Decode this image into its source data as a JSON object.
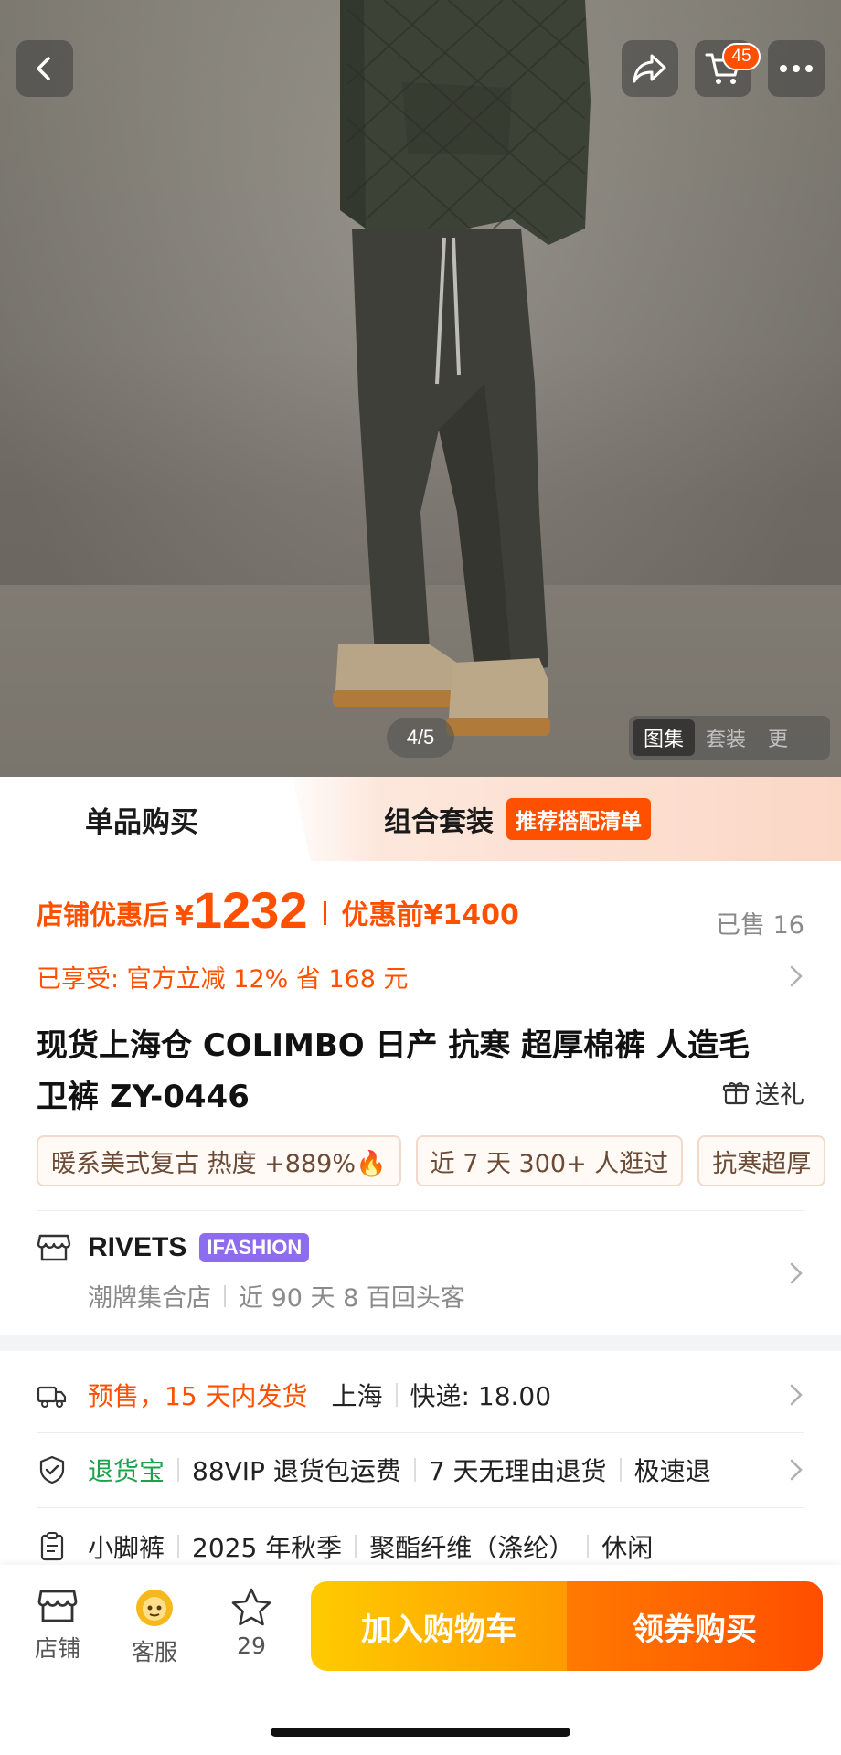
{
  "gallery": {
    "counter": "4/5",
    "tabs": [
      "图集",
      "套装",
      "更"
    ]
  },
  "header": {
    "cart_count": "45"
  },
  "mode_tabs": {
    "single": "单品购买",
    "combo": "组合套装",
    "combo_tag": "推荐搭配清单"
  },
  "price": {
    "label": "店铺优惠后",
    "symbol": "¥",
    "value": "1232",
    "before": "优惠前¥1400",
    "sold": "已售 16"
  },
  "discount": {
    "text": "已享受: 官方立减 12% 省 168 元"
  },
  "title": {
    "line1": "现货上海仓 COLIMBO 日产 抗寒 超厚棉裤 人造毛",
    "line2": "卫裤 ZY-0446",
    "gift": "送礼"
  },
  "tags": [
    "暖系美式复古 热度 +889%🔥",
    "近 7 天 300+ 人逛过",
    "抗寒超厚"
  ],
  "shop": {
    "name": "RIVETS",
    "badge": "IFASHION",
    "category": "潮牌集合店",
    "returning": "近 90 天 8 百回头客"
  },
  "shipping": {
    "presale": "预售，15 天内发货",
    "origin": "上海",
    "fee": "快递: 18.00"
  },
  "returns": {
    "name": "退货宝",
    "items": [
      "88VIP 退货包运费",
      "7 天无理由退货",
      "极速退"
    ]
  },
  "specs": {
    "items": [
      "小脚裤",
      "2025 年秋季",
      "聚酯纤维（涤纶）",
      "休闲"
    ]
  },
  "bottom": {
    "shop": "店铺",
    "service": "客服",
    "favorites": "29",
    "add_cart": "加入购物车",
    "buy": "领券购买"
  },
  "colors": {
    "accent": "#ff5000",
    "green": "#1aa34a",
    "cart_grad": [
      "#ffcb00",
      "#ff9a00"
    ],
    "buy_grad": [
      "#ff7a00",
      "#ff4e00"
    ]
  }
}
